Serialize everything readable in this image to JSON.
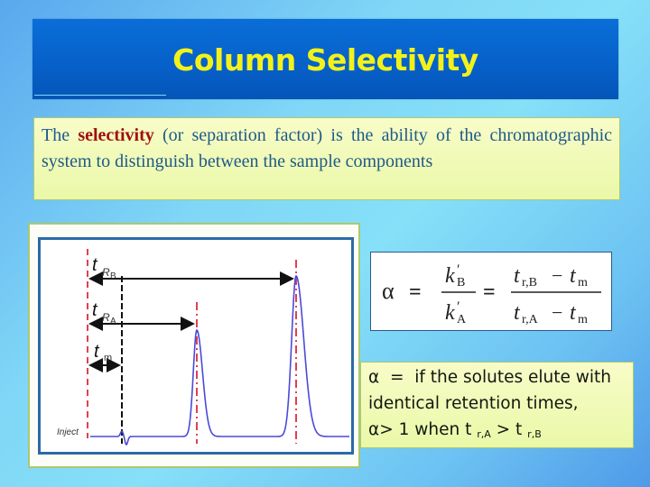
{
  "slide": {
    "title": "Column Selectivity",
    "definition": {
      "prefix": "The",
      "highlight": "selectivity",
      "rest": "(or separation factor)  is the ability of the chromatographic system to distinguish between the sample components"
    },
    "diagram": {
      "labels": {
        "t": "t",
        "tRB_sub": "R",
        "tRB_subsub": "B",
        "tRA_sub": "R",
        "tRA_subsub": "A",
        "tm_sub": "m",
        "inject": "Inject"
      },
      "colors": {
        "signal": "#4a4ad8",
        "marker_red": "#e04050",
        "marker_black": "#111111",
        "frame": "#2a6aa8"
      }
    },
    "formula": {
      "alpha": "α",
      "eq": "=",
      "k": "k",
      "prime": "′",
      "B": "B",
      "A": "A",
      "t": "t",
      "rB": "r,B",
      "rA": "r,A",
      "minus": "−",
      "m": "m"
    },
    "note": {
      "line1": "α  =  if the solutes elute with",
      "line2": "identical retention times,",
      "line3_prefix": "α> 1 when t ",
      "line3_sub1": "r,A",
      "line3_mid": " > t ",
      "line3_sub2": "r,B"
    },
    "colors": {
      "title_text": "#f2f21a",
      "title_bar": "#0660c8",
      "highlight": "#a01010",
      "body_text": "#1d5a8a"
    }
  }
}
